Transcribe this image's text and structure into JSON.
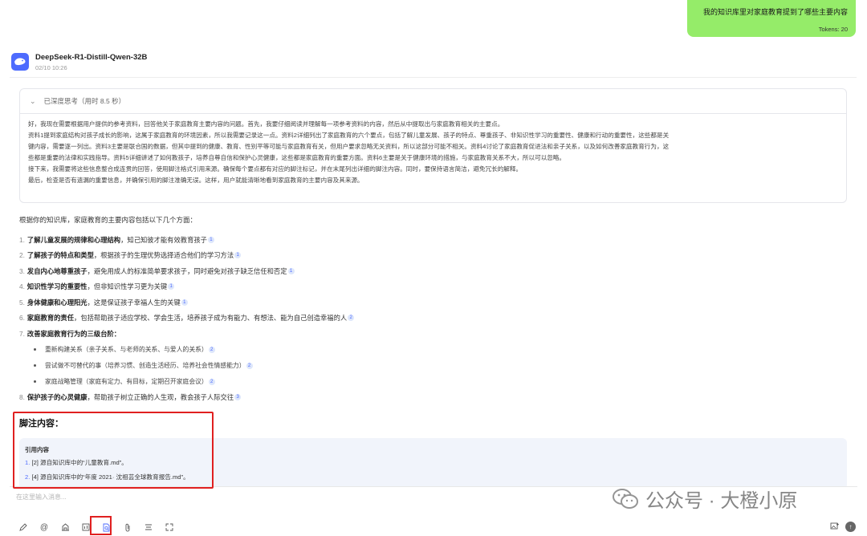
{
  "user": {
    "message": "我的知识库里对家庭教育提到了哪些主要内容",
    "tokens": "Tokens: 20"
  },
  "assistant": {
    "model_name": "DeepSeek-R1-Distill-Qwen-32B",
    "date": "02/10 10:26",
    "think_header": "已深度思考（用时 8.5 秒）",
    "think_lines": [
      "好，我现在需要根据用户提供的参考资料，回答他关于家庭教育主要内容的问题。首先，我要仔细阅读并理解每一项参考资料的内容，然后从中提取出与家庭教育相关的主要点。",
      "资料1提到家庭结构对孩子成长的影响，这属于家庭教育的环境因素，所以我需要记录这一点。资料2详细列出了家庭教育的六个要点，包括了解儿童发展、孩子的特点、尊重孩子、非知识性学习的重要性、健康和行动的重要性，这些都是关",
      "键内容，需要逐一列出。资料3主要是联合国的数据，但其中提到的健康、教育、性别平等可能与家庭教育有关，但用户要求忽略无关资料，所以这部分可能不相关。资料4讨论了家庭教育促进法和亲子关系，以及如何改善家庭教育行为，这",
      "些都是重要的法律和实践指导。资料5详细讲述了如何教孩子，培养自尊自信和保护心灵健康，这些都是家庭教育的重要方面。资料6主要是关于健康环境的措施，与家庭教育关系不大，所以可以忽略。",
      "接下来，我需要将这些信息整合成连贯的回答，使用脚注格式引用来源。确保每个要点都有对应的脚注标记，并在末尾列出详细的脚注内容。同时，要保持语言简洁，避免冗长的解释。",
      "最后，检查是否有遗漏的重要信息，并确保引用的脚注准确无误。这样，用户就能清晰地看到家庭教育的主要内容及其来源。"
    ],
    "intro": "根据你的知识库，家庭教育的主要内容包括以下几个方面：",
    "points": [
      {
        "num": "1.",
        "bold": "了解儿童发展的规律和心理结构",
        "rest": "，知己知彼才能有效教育孩子",
        "ref": "1"
      },
      {
        "num": "2.",
        "bold": "了解孩子的特点和类型",
        "rest": "，根据孩子的生理优势选择适合他们的学习方法",
        "ref": "1"
      },
      {
        "num": "3.",
        "bold": "发自内心地尊重孩子",
        "rest": "，避免用成人的标准简单要求孩子，同时避免对孩子缺乏信任和否定",
        "ref": "1"
      },
      {
        "num": "4.",
        "bold": "知识性学习的重要性",
        "rest": "，但非知识性学习更为关键",
        "ref": "1"
      },
      {
        "num": "5.",
        "bold": "身体健康和心理阳光",
        "rest": "，这是保证孩子幸福人生的关键",
        "ref": "1"
      },
      {
        "num": "6.",
        "bold": "家庭教育的责任",
        "rest": "，包括帮助孩子适应学校、学会生活，培养孩子成为有能力、有想法、能为自己创造幸福的人",
        "ref": "2"
      },
      {
        "num": "7.",
        "bold": "改善家庭教育行为的三级台阶：",
        "rest": "",
        "ref": ""
      }
    ],
    "sub_points": [
      {
        "text": "重新构建关系（亲子关系、与老师的关系、与爱人的关系）",
        "ref": "2"
      },
      {
        "text": "尝试做不可替代的事（培养习惯、创造生活经历、培养社会性情感能力）",
        "ref": "2"
      },
      {
        "text": "家庭战略管理（家庭有定力、有目标，定期召开家庭会议）",
        "ref": "2"
      }
    ],
    "point8": {
      "num": "8.",
      "bold": "保护孩子的心灵健康",
      "rest": "，帮助孩子树立正确的人生观，教会孩子人际交往",
      "ref": "3"
    },
    "footnote_title": "脚注内容：",
    "cite_label": "引用内容",
    "cites": [
      {
        "num": "1.",
        "text": "[2] 源自知识库中的“儿童教育.md”。"
      },
      {
        "num": "2.",
        "text": "[4] 源自知识库中的“年度 2021· 沈祖芸全球教育报告.md”。"
      }
    ]
  },
  "input": {
    "placeholder": "在这里输入消息..."
  },
  "watermark": "公众号 · 大橙小原",
  "colors": {
    "user_bubble": "#95ec69",
    "accent": "#4d6bfe",
    "highlight": "#e02020"
  }
}
